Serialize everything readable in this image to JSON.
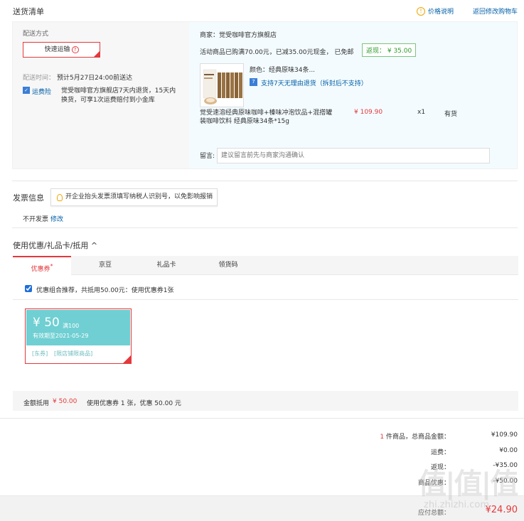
{
  "header": {
    "title": "送货清单",
    "price_note": "价格说明",
    "back_link": "返回修改购物车"
  },
  "shipping": {
    "method_label": "配送方式",
    "method_value": "快速运输",
    "time_label": "配送时间：",
    "time_value": "预计5月27日24:00前送达",
    "insurance_icon": "shield-icon",
    "insurance_label": "运费险",
    "insurance_desc": "觉受咖啡官方旗舰店7天内退货，15天内换货，可享1次运费赔付到小金库"
  },
  "order": {
    "merchant": "商家：觉受咖啡官方旗舰店",
    "promo": "活动商品已购满70.00元，已减35.00元现金， 已免邮",
    "cashback": "返现：  ¥ 35.00",
    "color": "颜色：经典原味34条...",
    "return_policy": "支持7天无理由退货（拆封后不支持）",
    "product_name": "觉受速溶经典原味咖啡+榛味冲泡饮品+混搭罐装咖啡饮料 经典原味34条*15g",
    "price": "¥ 109.90",
    "qty": "x1",
    "stock": "有货",
    "remark_label": "留言:",
    "remark_placeholder": "建议留言前先与商家沟通确认"
  },
  "invoice": {
    "title": "发票信息",
    "tip": "开企业抬头发票须填写纳税人识别号，以免影响报销",
    "value": "不开发票",
    "edit": "修改"
  },
  "coupon": {
    "title": "使用优惠/礼品卡/抵用 ^",
    "tabs": [
      "优惠券",
      "京豆",
      "礼品卡",
      "领货码"
    ],
    "tab_star": "*",
    "combo_text": "优惠组合推荐，共抵用50.00元：使用优惠券1张",
    "card": {
      "amount": "¥ 50",
      "condition": "满100",
      "valid": "有效期至2021-05-29",
      "tag1": "[东券]",
      "tag2": "[限店铺限商品]"
    },
    "deduct_label": "金额抵用",
    "deduct_amount": "¥ 50.00",
    "deduct_desc": "使用优惠券 1 张，优惠 50.00 元"
  },
  "totals": {
    "items_count": "1",
    "items_label": " 件商品，总商品金额：",
    "items_value": "¥109.90",
    "shipping_label": "运费：",
    "shipping_value": "¥0.00",
    "cashback_label": "返现：",
    "cashback_value": "-¥35.00",
    "discount_label": "商品优惠：",
    "discount_value": "-¥50.00",
    "pay_label": "应付总额：",
    "pay_value": "¥24.90"
  },
  "watermark": {
    "text": "值|值|值",
    "sub": "zhi.zhizhi.com"
  }
}
